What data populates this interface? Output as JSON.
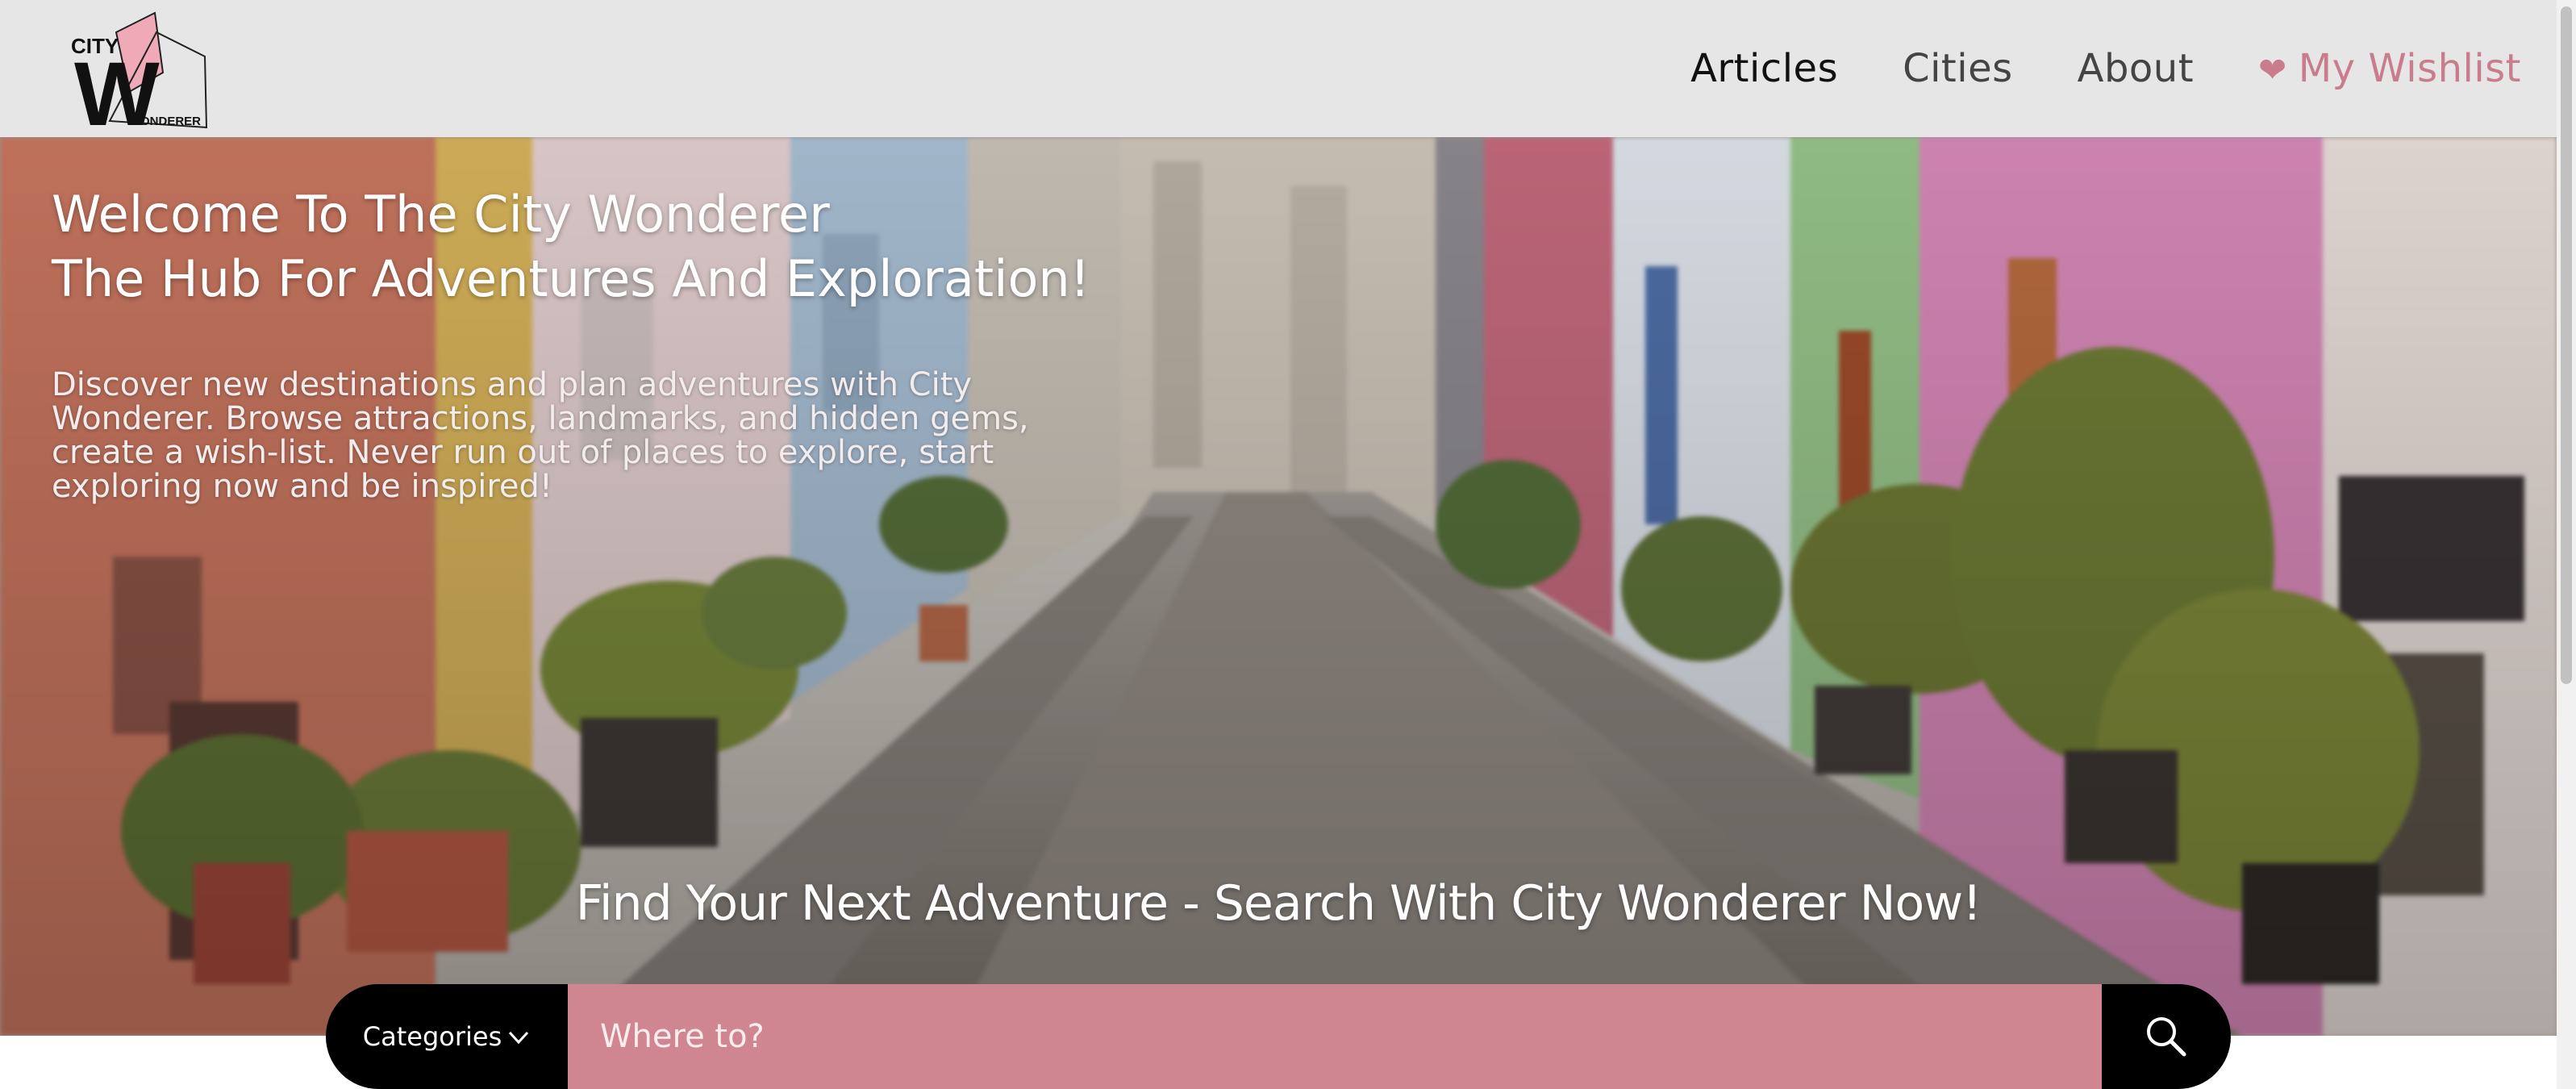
{
  "brand": {
    "logo_text_top": "CITY",
    "logo_letter": "W",
    "logo_text_bottom": "ONDERER",
    "accent_color": "#d08691"
  },
  "nav": {
    "items": [
      {
        "label": "Articles",
        "active": true
      },
      {
        "label": "Cities"
      },
      {
        "label": "About"
      }
    ],
    "wishlist": {
      "label": "My Wishlist",
      "icon": "heart-icon",
      "color": "#c97d8c"
    }
  },
  "hero": {
    "title_line1": "Welcome To The City Wonderer",
    "title_line2": "The Hub For Adventures And Exploration!",
    "description": "Discover new destinations and plan adventures with City Wonderer. Browse attractions, landmarks, and hidden gems, create a wish-list. Never run out of places to explore, start exploring now and be inspired!",
    "tagline": "Find Your Next Adventure - Search With City Wonderer Now!"
  },
  "search": {
    "categories_label": "Categories",
    "placeholder": "Where to?",
    "value": "",
    "icons": {
      "dropdown": "chevron-down-icon",
      "submit": "search-icon"
    }
  }
}
